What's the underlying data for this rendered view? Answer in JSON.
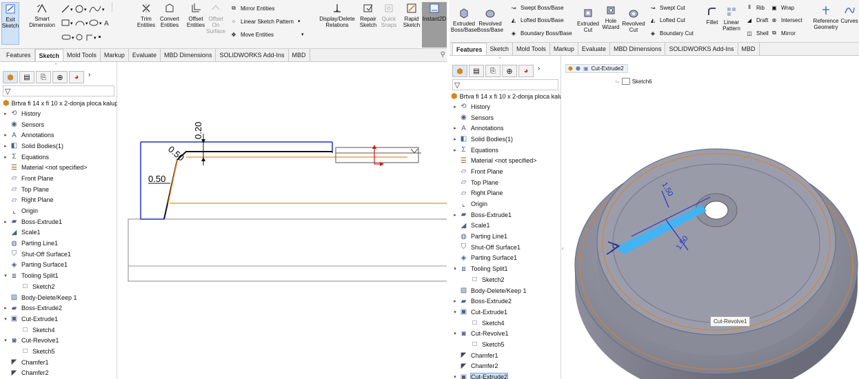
{
  "left": {
    "ribbon": {
      "exit_sketch": "Exit\nSketch",
      "smart_dimension": "Smart\nDimension",
      "trim_entities": "Trim\nEntities",
      "convert_entities": "Convert\nEntities",
      "offset_entities": "Offset\nEntities",
      "offset_on_surface": "Offset\nOn\nSurface",
      "mirror_entities": "Mirror Entities",
      "linear_sketch_pattern": "Linear Sketch Pattern",
      "move_entities": "Move Entities",
      "display_delete_relations": "Display/Delete\nRelations",
      "repair_sketch": "Repair\nSketch",
      "quick_snaps": "Quick\nSnaps",
      "rapid_sketch": "Rapid\nSketch",
      "instant2d": "Instant2D"
    },
    "tabs": [
      "Features",
      "Sketch",
      "Mold Tools",
      "Markup",
      "Evaluate",
      "MBD Dimensions",
      "SOLIDWORKS Add-Ins",
      "MBD"
    ],
    "active_tab": "Sketch",
    "part_name": "Brtva fi 14 x fi 10 x 2-donja ploca kalup",
    "tree": [
      {
        "label": "History",
        "icon": "history-icon",
        "arrow": "▸",
        "indent": 0
      },
      {
        "label": "Sensors",
        "icon": "sensors-icon",
        "arrow": "",
        "indent": 0
      },
      {
        "label": "Annotations",
        "icon": "annotations-icon",
        "arrow": "▸",
        "indent": 0
      },
      {
        "label": "Solid Bodies(1)",
        "icon": "solid-bodies-icon",
        "arrow": "▸",
        "indent": 0
      },
      {
        "label": "Equations",
        "icon": "equations-icon",
        "arrow": "▸",
        "indent": 0
      },
      {
        "label": "Material <not specified>",
        "icon": "material-icon",
        "arrow": "",
        "indent": 0
      },
      {
        "label": "Front Plane",
        "icon": "plane-icon",
        "arrow": "",
        "indent": 0
      },
      {
        "label": "Top Plane",
        "icon": "plane-icon",
        "arrow": "",
        "indent": 0
      },
      {
        "label": "Right Plane",
        "icon": "plane-icon",
        "arrow": "",
        "indent": 0
      },
      {
        "label": "Origin",
        "icon": "origin-icon",
        "arrow": "",
        "indent": 0
      },
      {
        "label": "Boss-Extrude1",
        "icon": "boss-extrude-icon",
        "arrow": "▸",
        "indent": 0
      },
      {
        "label": "Scale1",
        "icon": "scale-icon",
        "arrow": "",
        "indent": 0
      },
      {
        "label": "Parting Line1",
        "icon": "parting-line-icon",
        "arrow": "",
        "indent": 0
      },
      {
        "label": "Shut-Off Surface1",
        "icon": "shut-off-surface-icon",
        "arrow": "",
        "indent": 0
      },
      {
        "label": "Parting Surface1",
        "icon": "parting-surface-icon",
        "arrow": "",
        "indent": 0
      },
      {
        "label": "Tooling Split1",
        "icon": "tooling-split-icon",
        "arrow": "▾",
        "indent": 0
      },
      {
        "label": "Sketch2",
        "icon": "sketch-icon",
        "arrow": "",
        "indent": 1
      },
      {
        "label": "Body-Delete/Keep 1",
        "icon": "body-delete-icon",
        "arrow": "",
        "indent": 0
      },
      {
        "label": "Boss-Extrude2",
        "icon": "boss-extrude-icon",
        "arrow": "▸",
        "indent": 0
      },
      {
        "label": "Cut-Extrude1",
        "icon": "cut-extrude-icon",
        "arrow": "▾",
        "indent": 0
      },
      {
        "label": "Sketch4",
        "icon": "sketch-icon",
        "arrow": "",
        "indent": 1
      },
      {
        "label": "Cut-Revolve1",
        "icon": "cut-revolve-icon",
        "arrow": "▾",
        "indent": 0
      },
      {
        "label": "Sketch5",
        "icon": "sketch-icon",
        "arrow": "",
        "indent": 1
      },
      {
        "label": "Chamfer1",
        "icon": "chamfer-icon",
        "arrow": "",
        "indent": 0
      },
      {
        "label": "Chamfer2",
        "icon": "chamfer-icon",
        "arrow": "",
        "indent": 0
      }
    ],
    "dims": {
      "d1": "0.20",
      "d2": "0.50",
      "d3": "0.50"
    }
  },
  "right": {
    "ribbon": {
      "extruded_boss": "Extruded\nBoss/Base",
      "revolved_boss": "Revolved\nBoss/Base",
      "swept_boss": "Swept Boss/Base",
      "lofted_boss": "Lofted Boss/Base",
      "boundary_boss": "Boundary Boss/Base",
      "extruded_cut": "Extruded\nCut",
      "hole_wizard": "Hole\nWizard",
      "revolved_cut": "Revolved\nCut",
      "swept_cut": "Swept Cut",
      "lofted_cut": "Lofted Cut",
      "boundary_cut": "Boundary Cut",
      "fillet": "Fillet",
      "linear_pattern": "Linear\nPattern",
      "rib": "Rib",
      "draft": "Draft",
      "shell": "Shell",
      "wrap": "Wrap",
      "intersect": "Intersect",
      "mirror": "Mirror",
      "reference_geometry": "Reference\nGeometry",
      "curves": "Curves"
    },
    "tabs": [
      "Features",
      "Sketch",
      "Mold Tools",
      "Markup",
      "Evaluate",
      "MBD Dimensions",
      "SOLIDWORKS Add-Ins",
      "MBD"
    ],
    "active_tab": "Features",
    "part_name": "Brtva fi 14 x fi 10 x 2-donja ploca kalup",
    "tree": [
      {
        "label": "History",
        "icon": "history-icon",
        "arrow": "▸",
        "indent": 0
      },
      {
        "label": "Sensors",
        "icon": "sensors-icon",
        "arrow": "",
        "indent": 0
      },
      {
        "label": "Annotations",
        "icon": "annotations-icon",
        "arrow": "▸",
        "indent": 0
      },
      {
        "label": "Solid Bodies(1)",
        "icon": "solid-bodies-icon",
        "arrow": "▸",
        "indent": 0
      },
      {
        "label": "Equations",
        "icon": "equations-icon",
        "arrow": "▸",
        "indent": 0
      },
      {
        "label": "Material <not specified>",
        "icon": "material-icon",
        "arrow": "",
        "indent": 0
      },
      {
        "label": "Front Plane",
        "icon": "plane-icon",
        "arrow": "",
        "indent": 0
      },
      {
        "label": "Top Plane",
        "icon": "plane-icon",
        "arrow": "",
        "indent": 0
      },
      {
        "label": "Right Plane",
        "icon": "plane-icon",
        "arrow": "",
        "indent": 0
      },
      {
        "label": "Origin",
        "icon": "origin-icon",
        "arrow": "",
        "indent": 0
      },
      {
        "label": "Boss-Extrude1",
        "icon": "boss-extrude-icon",
        "arrow": "▸",
        "indent": 0
      },
      {
        "label": "Scale1",
        "icon": "scale-icon",
        "arrow": "",
        "indent": 0
      },
      {
        "label": "Parting Line1",
        "icon": "parting-line-icon",
        "arrow": "",
        "indent": 0
      },
      {
        "label": "Shut-Off Surface1",
        "icon": "shut-off-surface-icon",
        "arrow": "",
        "indent": 0
      },
      {
        "label": "Parting Surface1",
        "icon": "parting-surface-icon",
        "arrow": "",
        "indent": 0
      },
      {
        "label": "Tooling Split1",
        "icon": "tooling-split-icon",
        "arrow": "▾",
        "indent": 0
      },
      {
        "label": "Sketch2",
        "icon": "sketch-icon",
        "arrow": "",
        "indent": 1
      },
      {
        "label": "Body-Delete/Keep 1",
        "icon": "body-delete-icon",
        "arrow": "",
        "indent": 0
      },
      {
        "label": "Boss-Extrude2",
        "icon": "boss-extrude-icon",
        "arrow": "▸",
        "indent": 0
      },
      {
        "label": "Cut-Extrude1",
        "icon": "cut-extrude-icon",
        "arrow": "▾",
        "indent": 0
      },
      {
        "label": "Sketch4",
        "icon": "sketch-icon",
        "arrow": "",
        "indent": 1
      },
      {
        "label": "Cut-Revolve1",
        "icon": "cut-revolve-icon",
        "arrow": "▾",
        "indent": 0
      },
      {
        "label": "Sketch5",
        "icon": "sketch-icon",
        "arrow": "",
        "indent": 1
      },
      {
        "label": "Chamfer1",
        "icon": "chamfer-icon",
        "arrow": "",
        "indent": 0
      },
      {
        "label": "Chamfer2",
        "icon": "chamfer-icon",
        "arrow": "",
        "indent": 0
      },
      {
        "label": "Cut-Extrude2",
        "icon": "cut-extrude-icon",
        "arrow": "▾",
        "indent": 0,
        "selected": true
      },
      {
        "label": "(-) Sketch6",
        "icon": "sketch-icon",
        "arrow": "",
        "indent": 1
      }
    ],
    "breadcrumb_feature": "Cut-Extrude2",
    "breadcrumb_sketch": "Sketch6",
    "tooltip": "Cut-Revolve1",
    "dims": {
      "d1": "1.50",
      "d2": "1.50"
    }
  },
  "colors": {
    "sketch_blue": "#1f2fd0",
    "orange": "#f08a1e",
    "selection": "#2ea8f0",
    "model_gray": "#8e8f9d"
  }
}
